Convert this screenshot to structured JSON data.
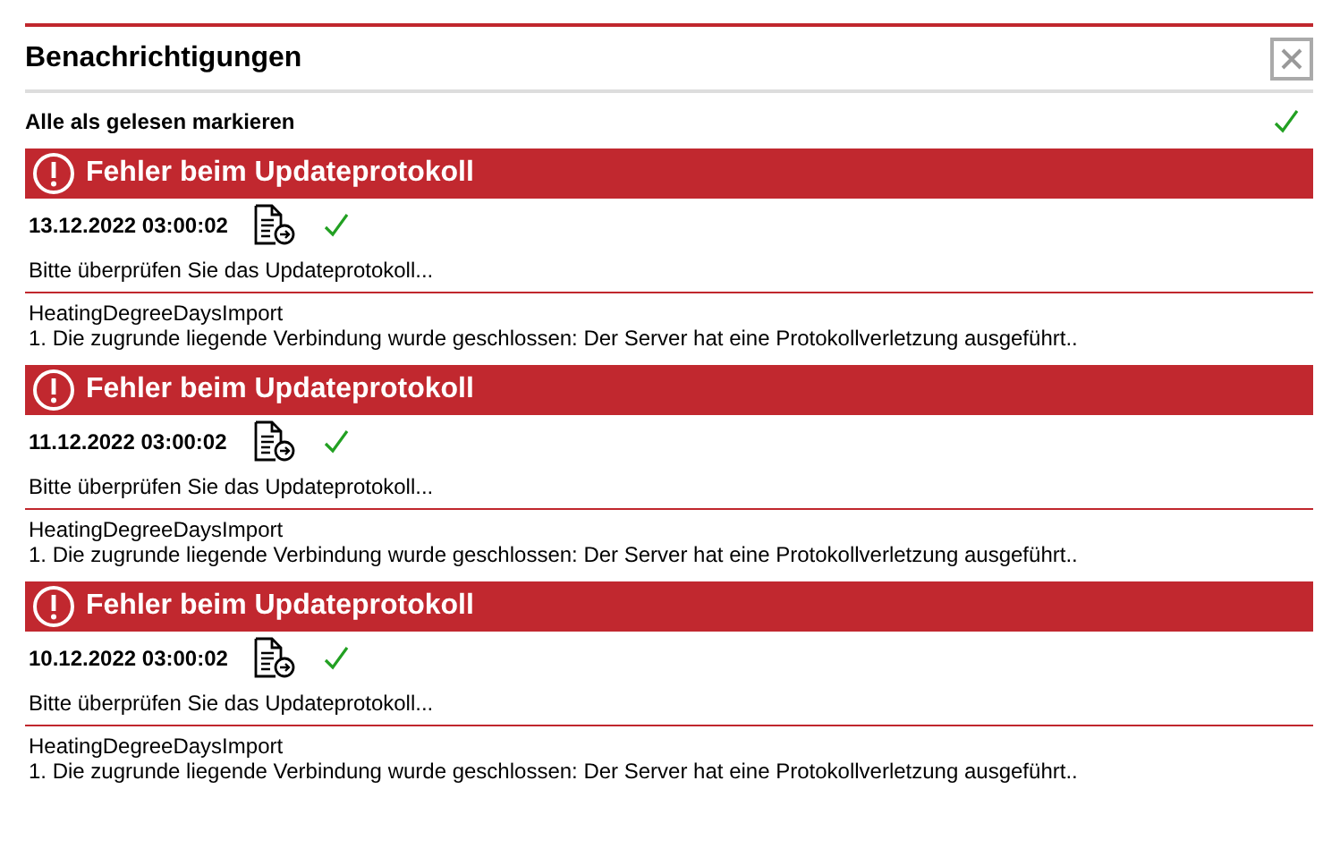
{
  "panel": {
    "title": "Benachrichtigungen",
    "mark_all": "Alle als gelesen markieren"
  },
  "notifications": [
    {
      "title": "Fehler beim Updateprotokoll",
      "date": "13.12.2022 03:00:02",
      "message": "Bitte überprüfen Sie das Updateprotokoll...",
      "details": [
        "HeatingDegreeDaysImport",
        "1. Die zugrunde liegende Verbindung wurde geschlossen: Der Server hat eine Protokollverletzung ausgeführt.."
      ]
    },
    {
      "title": "Fehler beim Updateprotokoll",
      "date": "11.12.2022 03:00:02",
      "message": "Bitte überprüfen Sie das Updateprotokoll...",
      "details": [
        "HeatingDegreeDaysImport",
        "1. Die zugrunde liegende Verbindung wurde geschlossen: Der Server hat eine Protokollverletzung ausgeführt.."
      ]
    },
    {
      "title": "Fehler beim Updateprotokoll",
      "date": "10.12.2022 03:00:02",
      "message": "Bitte überprüfen Sie das Updateprotokoll...",
      "details": [
        "HeatingDegreeDaysImport",
        "1. Die zugrunde liegende Verbindung wurde geschlossen: Der Server hat eine Protokollverletzung ausgeführt.."
      ]
    }
  ]
}
